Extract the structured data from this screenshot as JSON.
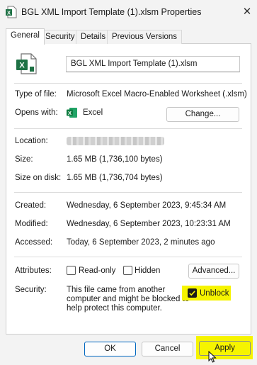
{
  "window": {
    "title": "BGL XML Import Template (1).xlsm Properties"
  },
  "tabs": [
    {
      "label": "General"
    },
    {
      "label": "Security"
    },
    {
      "label": "Details"
    },
    {
      "label": "Previous Versions"
    }
  ],
  "file": {
    "name": "BGL XML Import Template (1).xlsm"
  },
  "info": {
    "type_label": "Type of file:",
    "type_value": "Microsoft Excel Macro-Enabled Worksheet (.xlsm)",
    "opens_label": "Opens with:",
    "opens_value": "Excel",
    "change_label": "Change...",
    "location_label": "Location:",
    "size_label": "Size:",
    "size_value": "1.65 MB (1,736,100 bytes)",
    "size_disk_label": "Size on disk:",
    "size_disk_value": "1.65 MB (1,736,704 bytes)",
    "created_label": "Created:",
    "created_value": "Wednesday, 6 September 2023, 9:45:34 AM",
    "modified_label": "Modified:",
    "modified_value": "Wednesday, 6 September 2023, 10:23:31 AM",
    "accessed_label": "Accessed:",
    "accessed_value": "Today, 6 September 2023, 2 minutes ago",
    "attributes_label": "Attributes:",
    "readonly_label": "Read-only",
    "hidden_label": "Hidden",
    "advanced_label": "Advanced...",
    "security_label": "Security:",
    "security_line1": "This file came from another",
    "security_line2": "computer and might be blocked to",
    "security_line3": "help protect this computer.",
    "unblock_label": "Unblock"
  },
  "footer": {
    "ok": "OK",
    "cancel": "Cancel",
    "apply": "Apply"
  },
  "colors": {
    "excel_green": "#1e7145",
    "highlight": "#f6f400",
    "accent": "#0067c0"
  }
}
